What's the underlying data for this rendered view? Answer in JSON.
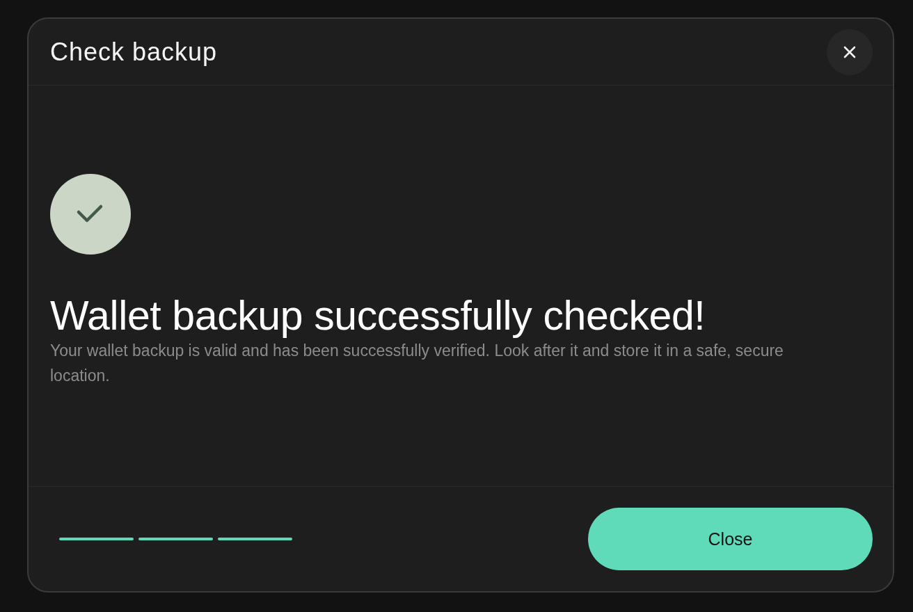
{
  "dialog": {
    "title": "Check backup",
    "status": {
      "kind": "success",
      "heading": "Wallet backup successfully checked!",
      "message": "Your wallet backup is valid and has been successfully verified. Look after it and store it in a safe, secure location."
    },
    "footer": {
      "steps": [
        {
          "completed": true
        },
        {
          "completed": true
        },
        {
          "completed": true
        }
      ],
      "primary_button": "Close"
    }
  }
}
